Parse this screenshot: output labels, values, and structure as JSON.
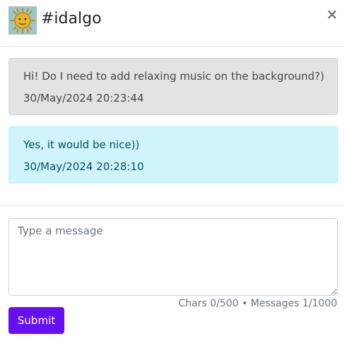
{
  "header": {
    "title": "#idalgo",
    "avatar_icon": "sun-face-icon",
    "close_icon": "close-icon",
    "close_glyph": "×"
  },
  "messages": [
    {
      "text": "Hi! Do I need to add relaxing music on the background?)",
      "time": "30/May/2024 20:23:44",
      "kind": "received"
    },
    {
      "text": "Yes, it would be nice))",
      "time": "30/May/2024 20:28:10",
      "kind": "sent"
    }
  ],
  "composer": {
    "placeholder": "Type a message",
    "value": "",
    "counter": "Chars 0/500 • Messages 1/1000",
    "submit_label": "Submit"
  },
  "colors": {
    "accent": "#6610f2",
    "received_bg": "#e2e3e5",
    "sent_bg": "#cff4fc"
  }
}
